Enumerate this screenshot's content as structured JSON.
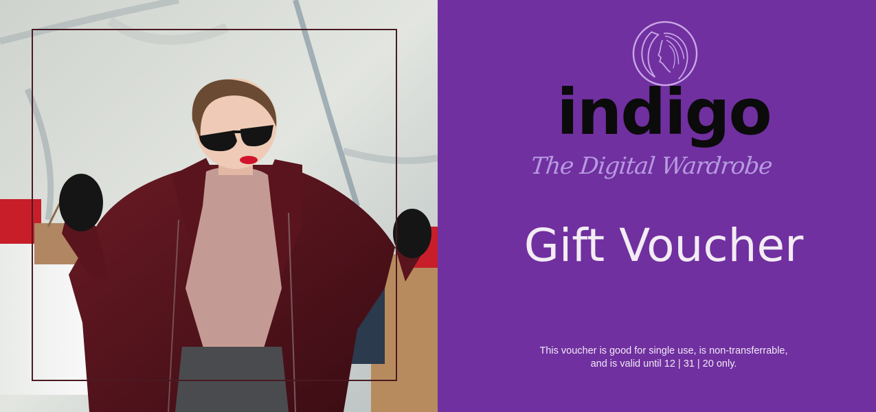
{
  "photo": {
    "icon": "woman-with-shopping-bags-photo"
  },
  "brand": {
    "name": "indigo",
    "tagline": "The Digital Wardrobe",
    "emblem_icon": "woman-profile-crescent-icon",
    "panel_color": "#7030a0",
    "tagline_color": "#b79ae0"
  },
  "voucher": {
    "title": "Gift Voucher",
    "terms_line1": "This voucher is good for single use, is non-transferrable,",
    "terms_line2": "and is valid until 12 | 31 | 20 only."
  }
}
